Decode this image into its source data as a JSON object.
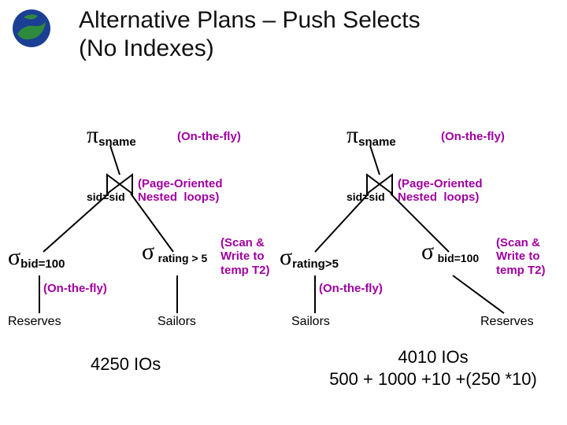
{
  "title": "Alternative Plans – Push Selects\n(No Indexes)",
  "left": {
    "pi_sub": "sname",
    "pi_annot": "(On-the-fly)",
    "join_cond": "sid=sid",
    "join_annot": "(Page-Oriented\nNested  loops)",
    "sigma_left_sub": "bid=100",
    "sigma_left_annot": "(On-the-fly)",
    "sigma_right_sub": "rating > 5",
    "sigma_right_annot": "(Scan &\nWrite to\ntemp T2)",
    "left_rel": "Reserves",
    "right_rel": "Sailors",
    "cost": "4250 IOs"
  },
  "right": {
    "pi_sub": "sname",
    "pi_annot": "(On-the-fly)",
    "join_cond": "sid=sid",
    "join_annot": "(Page-Oriented\nNested  loops)",
    "sigma_left_sub": "rating>5",
    "sigma_left_annot": "(On-the-fly)",
    "sigma_right_sub": "bid=100",
    "sigma_right_annot": "(Scan &\nWrite to\ntemp T2)",
    "left_rel": "Sailors",
    "right_rel": "Reserves",
    "cost_line1": "4010 IOs",
    "cost_line2": "500 + 1000 +10 +(250 *10)"
  }
}
